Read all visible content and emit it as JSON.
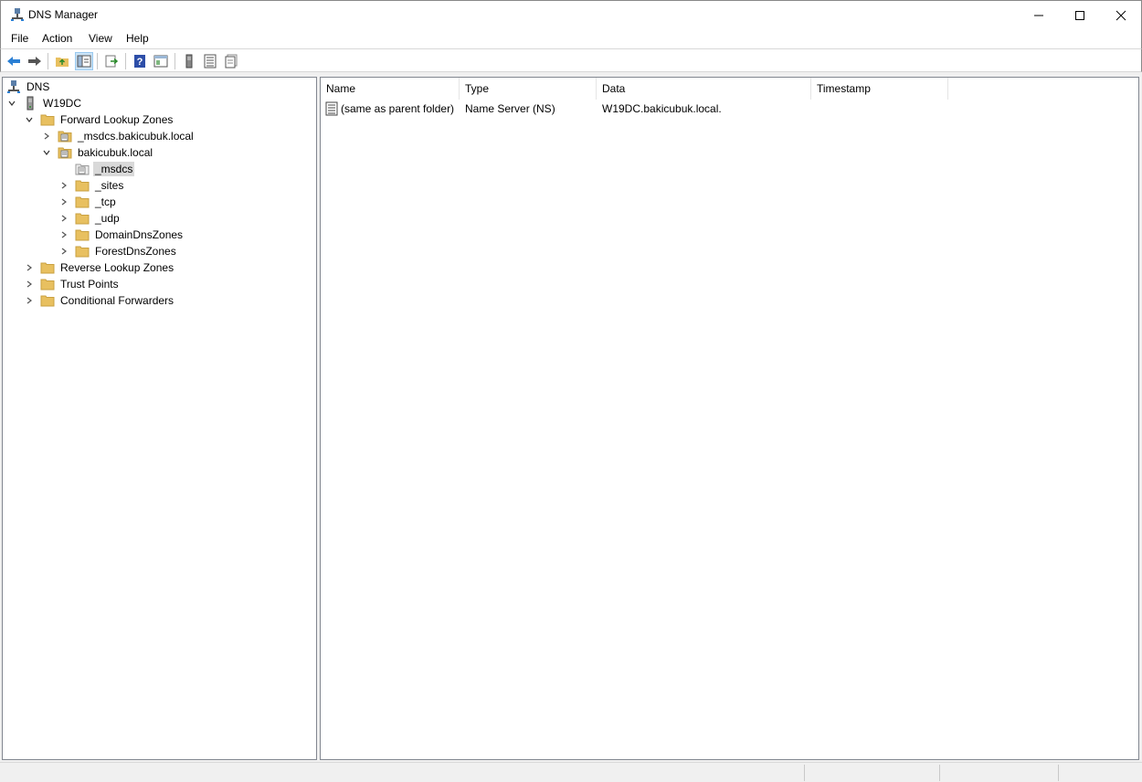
{
  "window": {
    "title": "DNS Manager",
    "controls": {
      "minimize": "—",
      "maximize": "☐",
      "close": "✕"
    }
  },
  "menu": [
    "File",
    "Action",
    "View",
    "Help"
  ],
  "toolbar": {
    "icons": [
      "back-arrow-icon",
      "forward-arrow-icon",
      "up-folder-icon",
      "show-hide-tree-icon",
      "export-list-icon",
      "help-icon",
      "console-view-icon",
      "server-icon",
      "list-view-icon",
      "properties-icon"
    ]
  },
  "tree": {
    "root": "DNS",
    "server": "W19DC",
    "forward_lookup_zones": "Forward Lookup Zones",
    "zone_msdcs_bakicubuk": "_msdcs.bakicubuk.local",
    "zone_bakicubuk": "bakicubuk.local",
    "folder_msdcs": "_msdcs",
    "folder_sites": "_sites",
    "folder_tcp": "_tcp",
    "folder_udp": "_udp",
    "folder_domaindnszones": "DomainDnsZones",
    "folder_forestdnszones": "ForestDnsZones",
    "reverse_lookup_zones": "Reverse Lookup Zones",
    "trust_points": "Trust Points",
    "conditional_forwarders": "Conditional Forwarders",
    "selected": "_msdcs"
  },
  "list": {
    "columns": [
      "Name",
      "Type",
      "Data",
      "Timestamp"
    ],
    "rows": [
      {
        "name": "(same as parent folder)",
        "type": "Name Server (NS)",
        "data": "W19DC.bakicubuk.local.",
        "timestamp": ""
      }
    ]
  },
  "colors": {
    "selection": "#d9d9d9",
    "folder": "#e8c060",
    "arrow_blue": "#2a7fd4"
  }
}
